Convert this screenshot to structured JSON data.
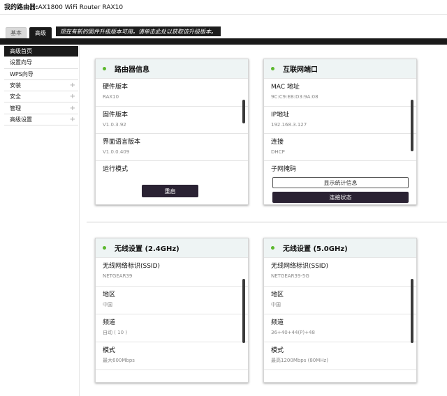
{
  "header": {
    "label": "我的路由器:",
    "model": "AX1800 WiFi Router RAX10"
  },
  "tabs": [
    {
      "label": "基本"
    },
    {
      "label": "高级"
    }
  ],
  "notice": "现在有新的固件升级版本可用。请单击此处以获取该升级版本。",
  "sidebar": {
    "items": [
      {
        "label": "高级首页",
        "active": true
      },
      {
        "label": "设置向导"
      },
      {
        "label": "WPS向导"
      },
      {
        "label": "安装",
        "expand": "+"
      },
      {
        "label": "安全",
        "expand": "+"
      },
      {
        "label": "管理",
        "expand": "+"
      },
      {
        "label": "高级设置",
        "expand": "+"
      }
    ]
  },
  "cards": {
    "router_info": {
      "title": "路由器信息",
      "rows": [
        {
          "label": "硬件版本",
          "value": "RAX10"
        },
        {
          "label": "固件版本",
          "value": "V1.0.3.92"
        },
        {
          "label": "界面语言版本",
          "value": "V1.0.0.409"
        },
        {
          "label": "运行模式",
          "value": ""
        }
      ],
      "button": "重启"
    },
    "internet_port": {
      "title": "互联网端口",
      "rows": [
        {
          "label": "MAC 地址",
          "value": "9C:C9:EB:D3:9A:08"
        },
        {
          "label": "IP地址",
          "value": "192.168.3.127"
        },
        {
          "label": "连接",
          "value": "DHCP"
        },
        {
          "label": "子网掩码",
          "value": ""
        }
      ],
      "button_stats": "显示统计信息",
      "button_status": "连接状态"
    },
    "wifi_24": {
      "title": "无线设置 (2.4GHz)",
      "rows": [
        {
          "label": "无线网络标识(SSID)",
          "value": "NETGEAR39"
        },
        {
          "label": "地区",
          "value": "中国"
        },
        {
          "label": "频道",
          "value": "自动 ( 10 )"
        },
        {
          "label": "模式",
          "value": "最大600Mbps"
        }
      ]
    },
    "wifi_5": {
      "title": "无线设置 (5.0GHz)",
      "rows": [
        {
          "label": "无线网络标识(SSID)",
          "value": "NETGEAR39-5G"
        },
        {
          "label": "地区",
          "value": "中国"
        },
        {
          "label": "频道",
          "value": "36+40+44(P)+48"
        },
        {
          "label": "模式",
          "value": "最高1200Mbps (80MHz)"
        }
      ]
    }
  },
  "colors": {
    "accent_dot": "#5cb82e",
    "dark": "#1a1a1a",
    "header_bg": "#eef4f4"
  }
}
